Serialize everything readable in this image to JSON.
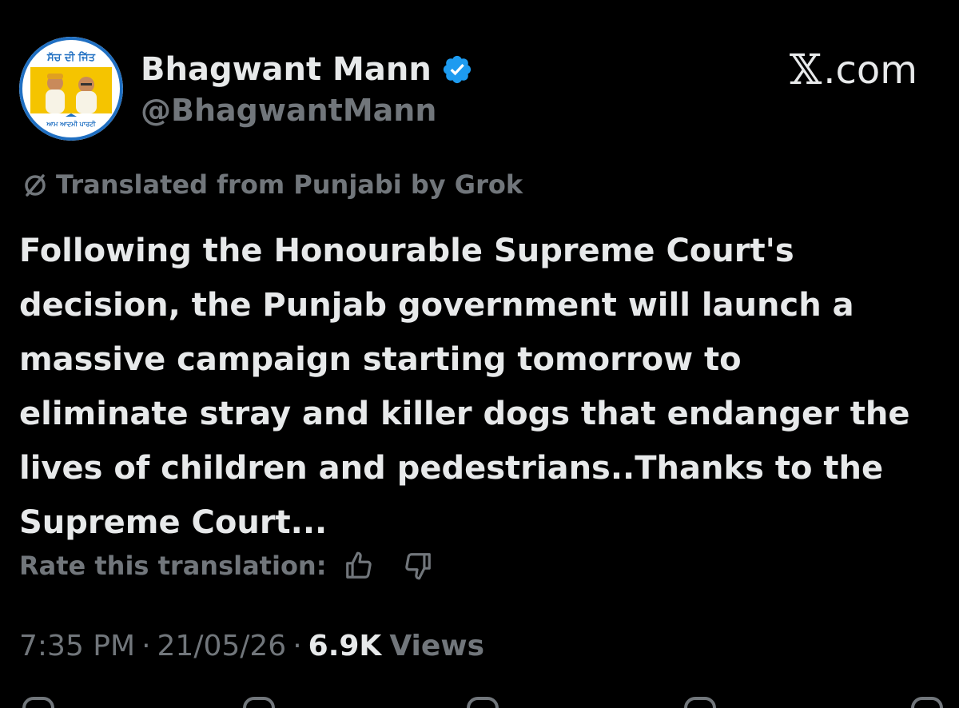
{
  "author": {
    "display_name": "Bhagwant Mann",
    "handle": "@BhagwantMann",
    "verified": true,
    "avatar": {
      "top_text": "ਸੱਚ ਦੀ ਜਿੱਤ",
      "bottom_text": "ਆਮ ਆਦਮੀ ਪਾਰਟੀ",
      "ring_color": "#1f6fc2",
      "banner_color": "#f5c400"
    }
  },
  "brand": {
    "label": ".com",
    "icon": "x-logo-icon"
  },
  "translation": {
    "notice": "Translated from Punjabi by Grok",
    "icon": "translate-icon",
    "rate_label": "Rate this translation:"
  },
  "tweet": {
    "lines": [
      "Following the Honourable Supreme Court's",
      "decision, the Punjab government will launch a",
      "massive campaign starting tomorrow to",
      "eliminate stray and killer dogs that endanger the",
      "lives of children and pedestrians..Thanks to the",
      "Supreme Court..."
    ]
  },
  "meta": {
    "time": "7:35 PM",
    "separator": "·",
    "date": "21/05/26",
    "views_count": "6.9K",
    "views_label": "Views"
  },
  "colors": {
    "background": "#000000",
    "primary_text": "#e7e9ea",
    "secondary_text": "#71767b",
    "verified_blue": "#1d9bf0"
  }
}
